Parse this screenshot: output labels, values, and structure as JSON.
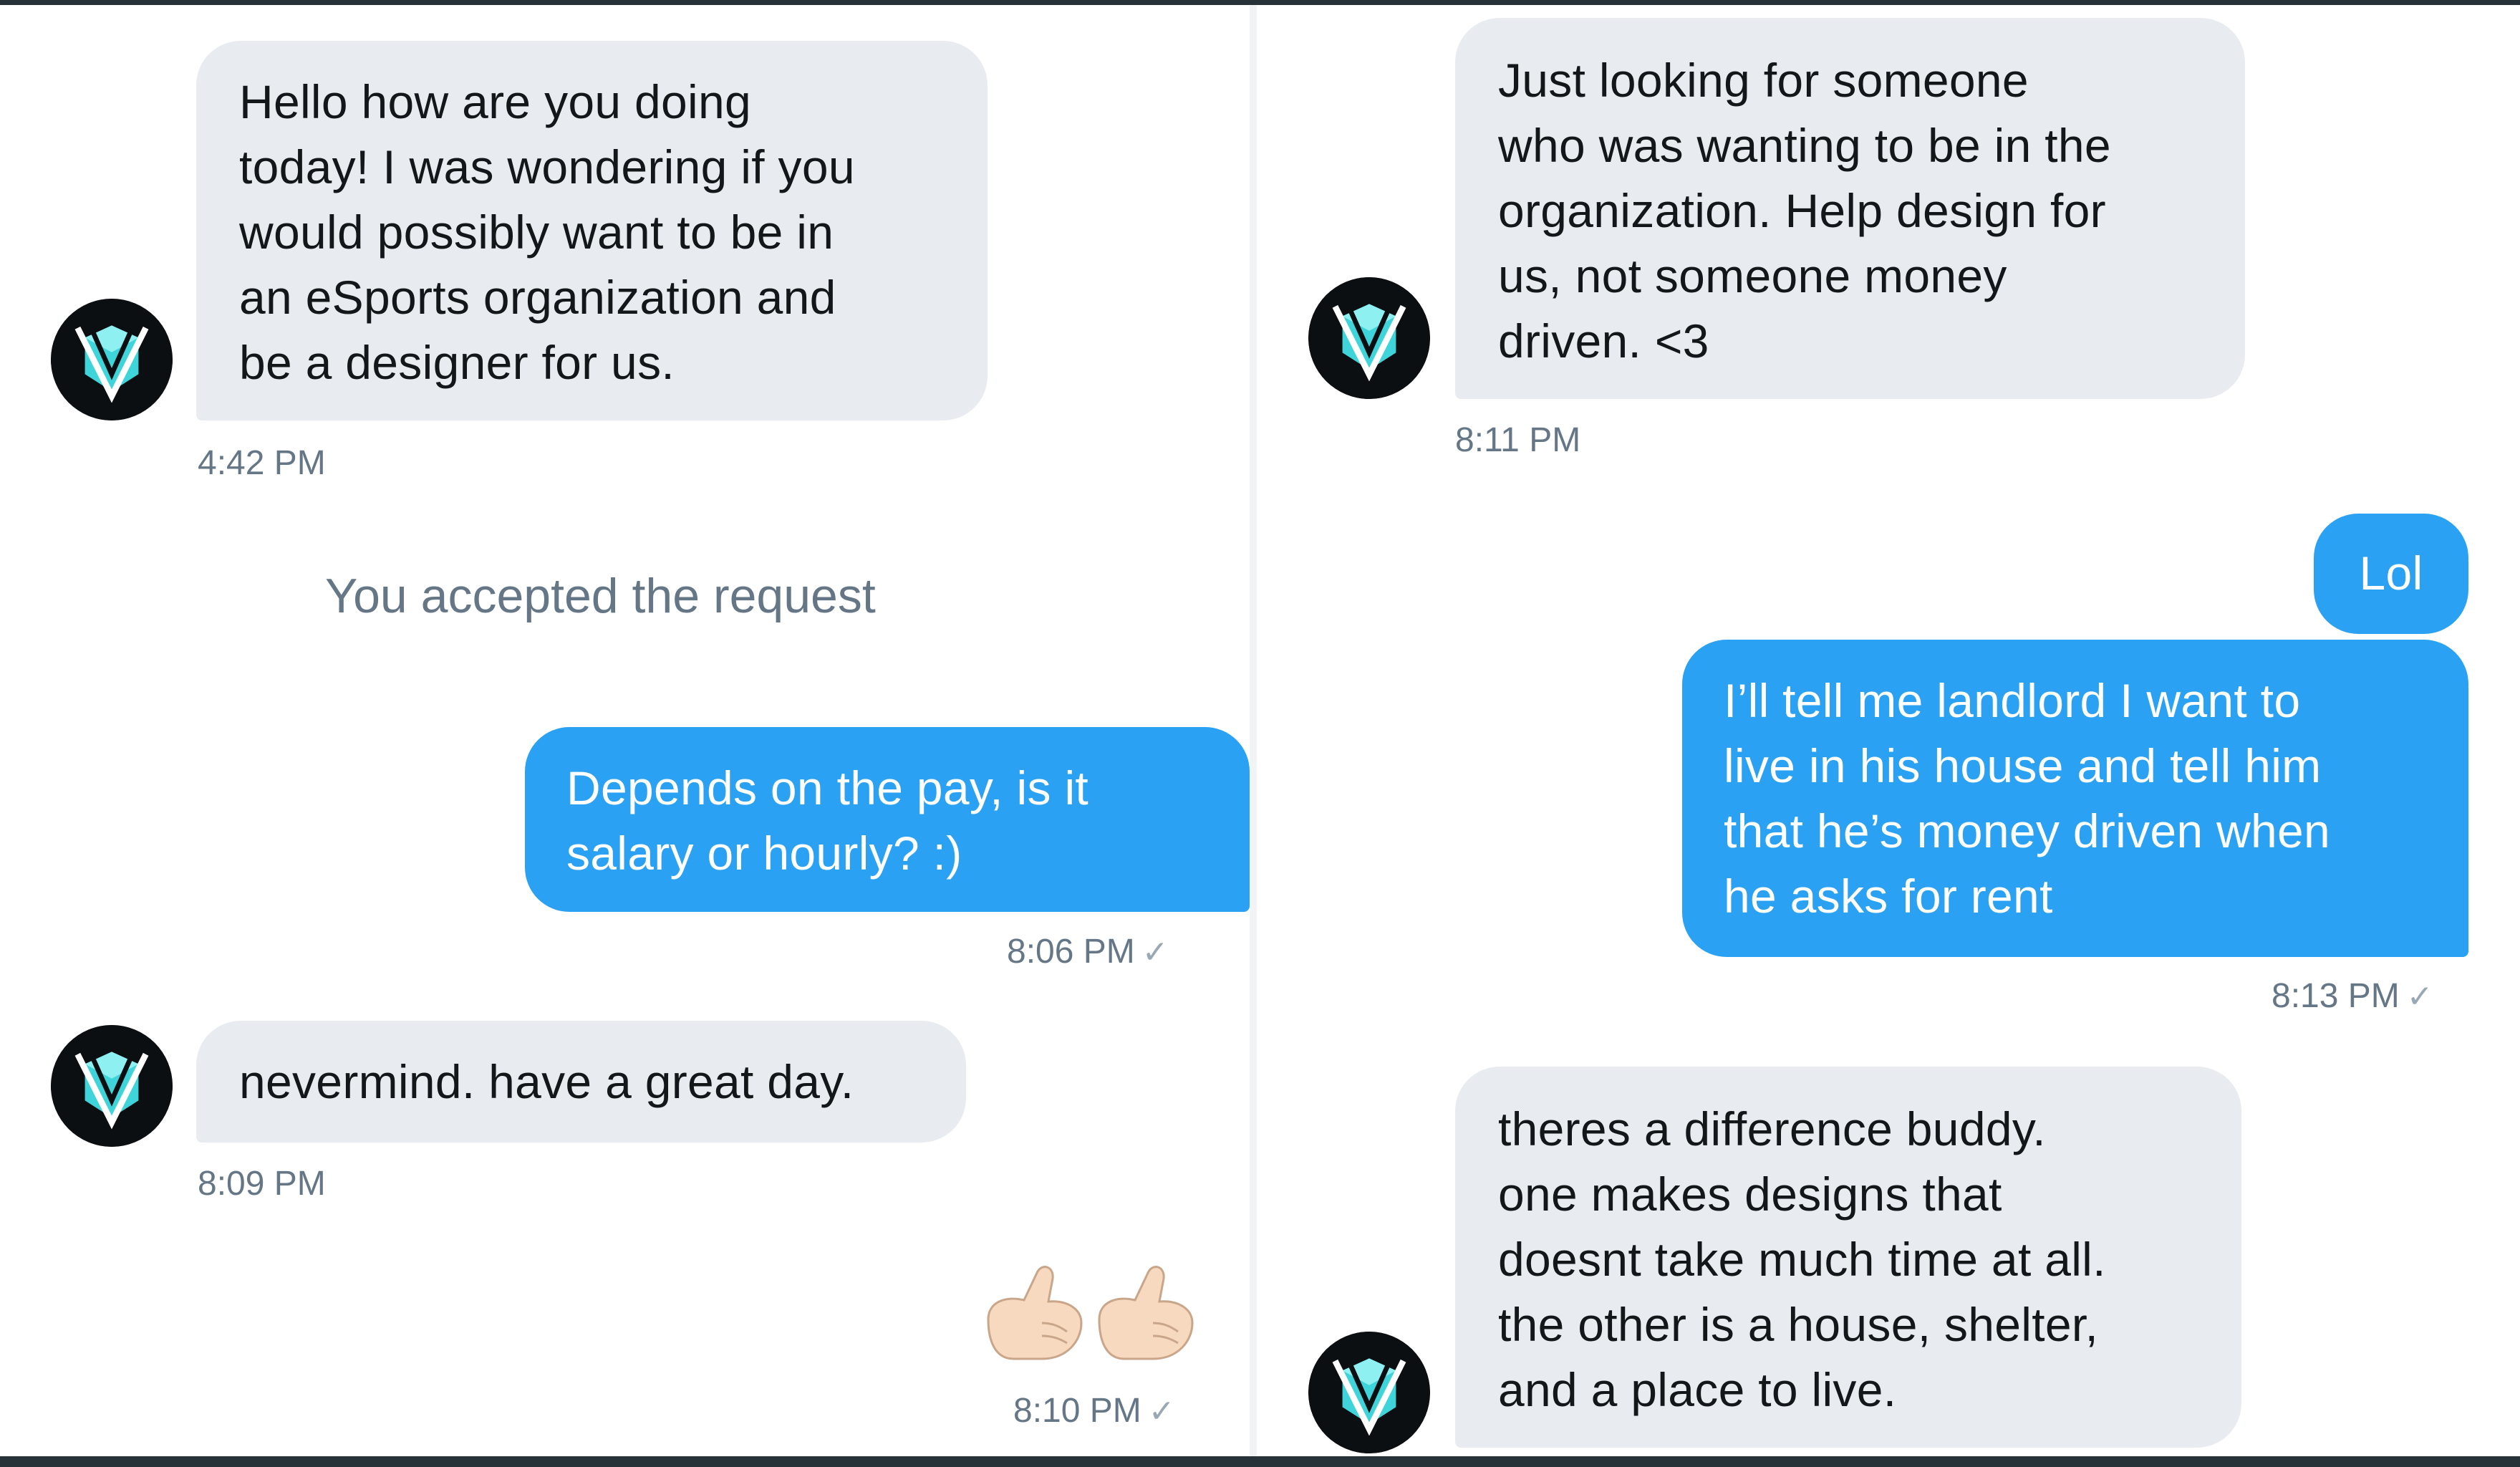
{
  "conversation": {
    "left": {
      "msg1": {
        "lines": [
          "Hello how are you doing",
          "today! I was wondering if you",
          "would possibly want to be in",
          "an eSports organization and",
          "be a designer for us."
        ],
        "time": "4:42 PM"
      },
      "system_note": "You accepted the request",
      "msg2": {
        "lines": [
          "Depends on the pay, is it",
          "salary or hourly? :)"
        ],
        "time": "8:06 PM"
      },
      "msg3": {
        "lines": [
          "nevermind. have a great day."
        ],
        "time": "8:09 PM"
      },
      "msg4": {
        "emoji": "call-me-hand-emoji x2",
        "time": "8:10 PM"
      }
    },
    "right": {
      "msg5": {
        "lines": [
          "Just looking for someone",
          "who was wanting to be in the",
          "organization. Help design for",
          "us, not someone money",
          "driven. <3"
        ],
        "time": "8:11 PM"
      },
      "msg6": {
        "lines": [
          "Lol"
        ]
      },
      "msg7": {
        "lines": [
          "I’ll tell me landlord I want to",
          "live in his house and tell him",
          "that he’s money driven when",
          "he asks for rent"
        ],
        "time": "8:13 PM"
      },
      "msg8": {
        "lines": [
          "theres a difference buddy.",
          "one makes designs that",
          "doesnt take much time at all.",
          "the other is a house, shelter,",
          "and a place to live."
        ]
      }
    }
  },
  "theme": {
    "outgoing_bubble": "#2aa1f2",
    "incoming_bubble": "#e8ecf0",
    "timestamp_text": "#657786",
    "avatar_accent": "#3fd4d9"
  },
  "icons": {
    "avatar": "team-logo-v-icon",
    "read_receipt": "checkmark-icon",
    "emoji": "call-me-hand-emoji"
  }
}
